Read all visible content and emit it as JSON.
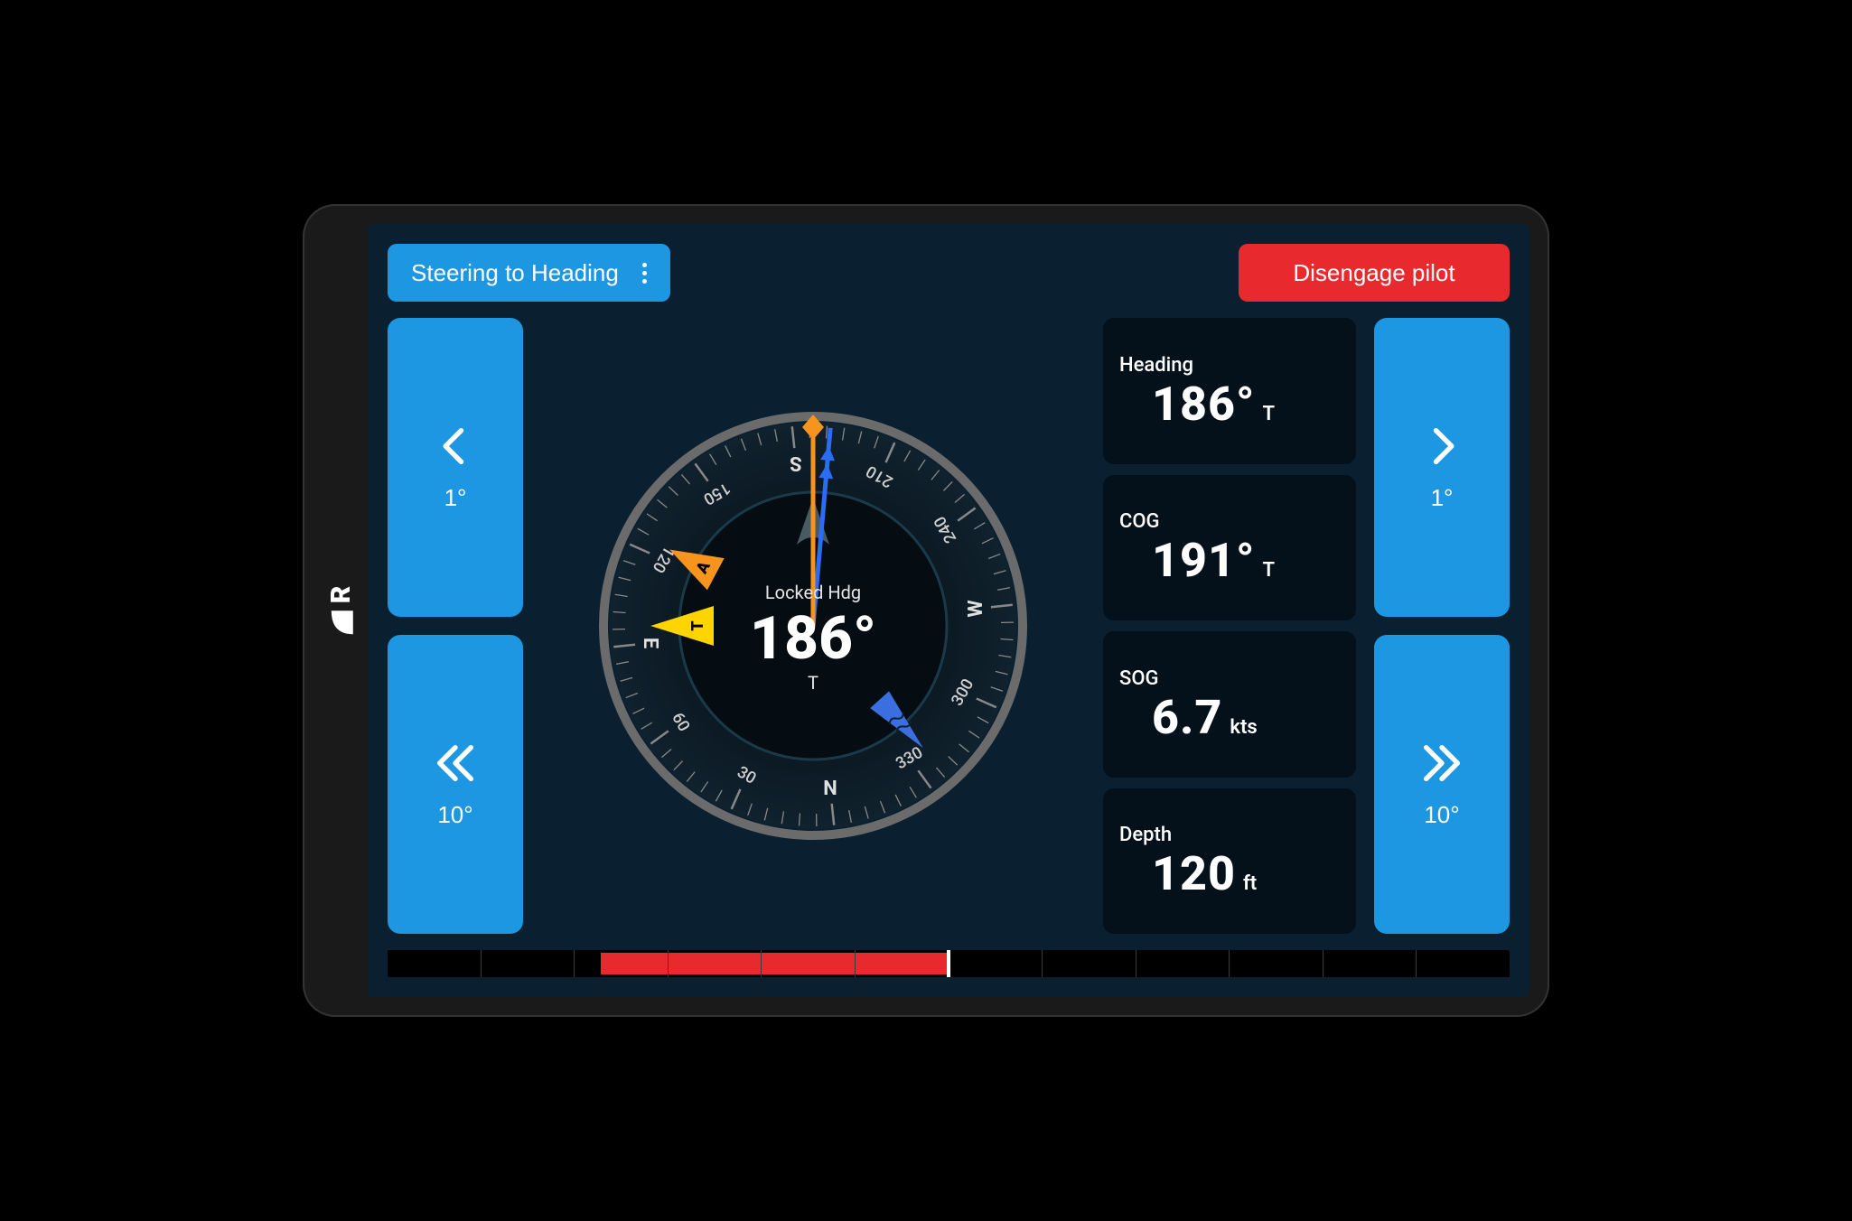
{
  "brand": {
    "letter": "R"
  },
  "topbar": {
    "mode_label": "Steering to Heading",
    "disengage_label": "Disengage pilot"
  },
  "adjust": {
    "left_small": "1°",
    "left_large": "10°",
    "right_small": "1°",
    "right_large": "10°"
  },
  "compass": {
    "center_label": "Locked Hdg",
    "center_value": "186°",
    "center_unit": "T",
    "ring_labels": [
      "150",
      "210",
      "240",
      "300",
      "330",
      "30",
      "60",
      "120"
    ],
    "cardinals": [
      "S",
      "W",
      "N",
      "E"
    ],
    "heading_deg": 186,
    "cog_deg": 191,
    "wind_app_deg": 120,
    "wind_true_deg": 95,
    "tide_deg": 325
  },
  "data": {
    "heading": {
      "label": "Heading",
      "value": "186°",
      "unit": "T"
    },
    "cog": {
      "label": "COG",
      "value": "191°",
      "unit": "T"
    },
    "sog": {
      "label": "SOG",
      "value": "6.7",
      "unit": "kts"
    },
    "depth": {
      "label": "Depth",
      "value": "120",
      "unit": "ft"
    }
  },
  "rudder": {
    "fill_start_pct": 19,
    "fill_end_pct": 50,
    "tick_count": 12
  },
  "colors": {
    "accent_blue": "#1e97e2",
    "danger_red": "#e82a2f",
    "bg_dark": "#0a2030",
    "card_dark": "#04101a",
    "wind_app": "#f7941d",
    "wind_true": "#ffd400",
    "cog_blue": "#2a6df4",
    "tide_blue": "#3b6fe0"
  }
}
